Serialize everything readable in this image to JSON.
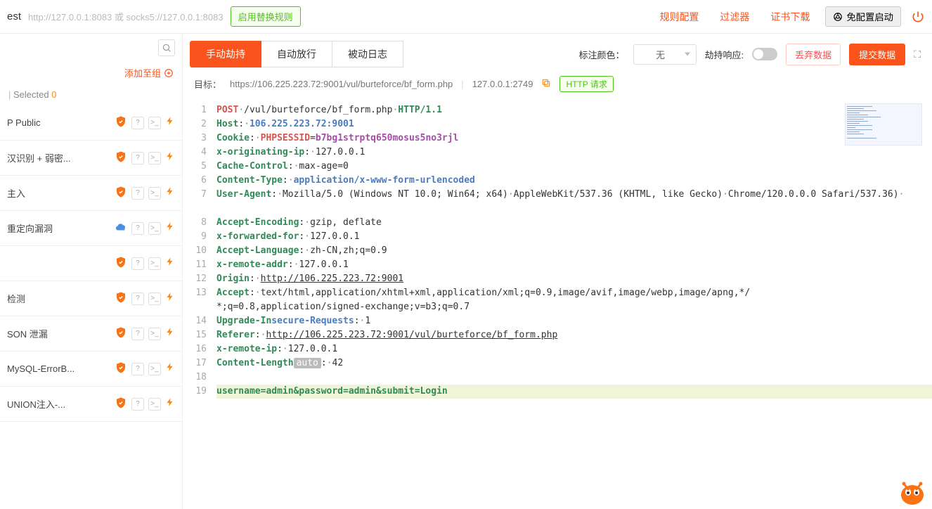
{
  "topbar": {
    "title_suffix": "est",
    "proxy": "http://127.0.0.1:8083 或 socks5://127.0.0.1:8083",
    "enable_rules_btn": "启用替换规则",
    "nav": {
      "rules": "规则配置",
      "filters": "过滤器",
      "cert": "证书下载",
      "launch": "免配置启动"
    }
  },
  "sidebar": {
    "add_group": "添加至组",
    "selected_label": "Selected",
    "selected_count": "0",
    "items": [
      {
        "label": "P Public",
        "icon": "shield-orange"
      },
      {
        "label": "汉识别 + 弱密...",
        "icon": "shield-orange"
      },
      {
        "label": "主入",
        "icon": "shield-orange"
      },
      {
        "label": "重定向漏洞",
        "icon": "cloud-blue"
      },
      {
        "label": "",
        "icon": "shield-orange"
      },
      {
        "label": "检测",
        "icon": "shield-orange"
      },
      {
        "label": "SON 泄漏",
        "icon": "shield-orange"
      },
      {
        "label": "MySQL-ErrorB...",
        "icon": "shield-orange"
      },
      {
        "label": "UNION注入-...",
        "icon": "shield-orange"
      }
    ]
  },
  "tabs": {
    "manual": "手动劫持",
    "auto": "自动放行",
    "passive": "被动日志"
  },
  "toolbar": {
    "mark_color": "标注颜色：",
    "mark_color_value": "无",
    "hijack_resp": "劫持响应:",
    "discard": "丢弃数据",
    "submit": "提交数据"
  },
  "target": {
    "label": "目标：",
    "url": "https://106.225.223.72:9001/vul/burteforce/bf_form.php",
    "client": "127.0.0.1:2749",
    "badge": "HTTP 请求"
  },
  "http": {
    "method": "POST",
    "path": "/vul/burteforce/bf_form.php",
    "version": "HTTP/1.1",
    "headers": {
      "Host": "106.225.223.72:9001",
      "Cookie_key": "PHPSESSID",
      "Cookie_val": "b7bg1strptq650mosus5no3rjl",
      "x_originating_ip": "127.0.0.1",
      "Cache_Control": "max-age=0",
      "Content_Type": "application/x-www-form-urlencoded",
      "User_Agent": "Mozilla/5.0 (Windows NT 10.0; Win64; x64) AppleWebKit/537.36 (KHTML, like Gecko) Chrome/120.0.0.0 Safari/537.36",
      "Accept_Encoding": "gzip, deflate",
      "x_forwarded_for": "127.0.0.1",
      "Accept_Language": "zh-CN,zh;q=0.9",
      "x_remote_addr": "127.0.0.1",
      "Origin": "http://106.225.223.72:9001",
      "Accept": "text/html,application/xhtml+xml,application/xml;q=0.9,image/avif,image/webp,image/apng,*/*;q=0.8,application/signed-exchange;v=b3;q=0.7",
      "Upgrade_Insecure_Requests": "1",
      "Referer": "http://106.225.223.72:9001/vul/burteforce/bf_form.php",
      "x_remote_ip": "127.0.0.1",
      "Content_Length_auto": "auto",
      "Content_Length": "42"
    },
    "body": "username=admin&password=admin&submit=Login"
  },
  "line_numbers": [
    "1",
    "2",
    "3",
    "4",
    "5",
    "6",
    "7",
    "",
    "8",
    "9",
    "10",
    "11",
    "12",
    "13",
    "",
    "14",
    "15",
    "16",
    "17",
    "18",
    "19"
  ]
}
